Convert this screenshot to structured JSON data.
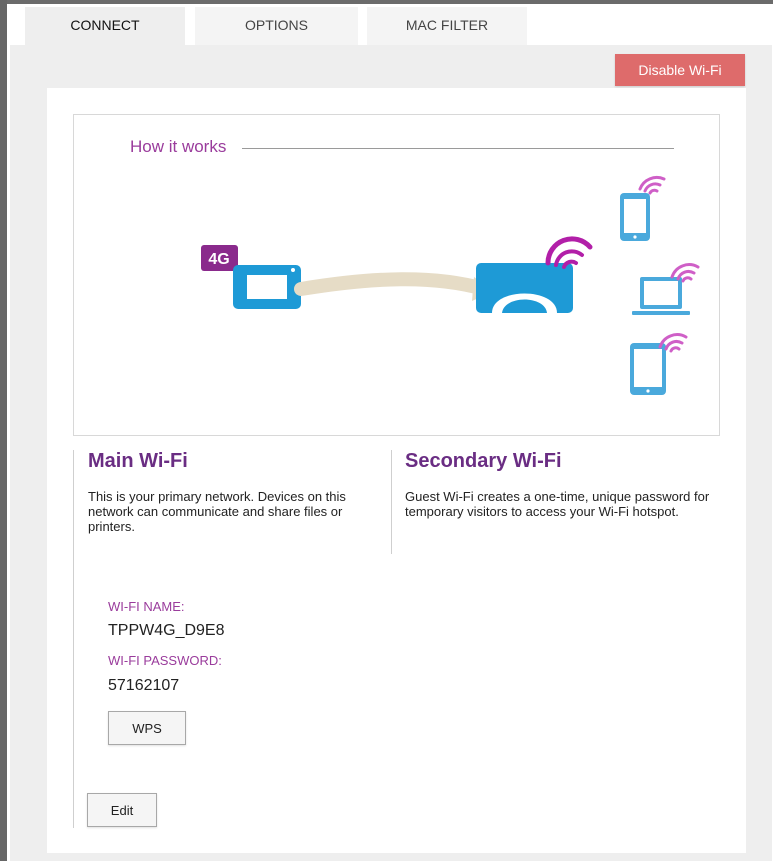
{
  "tabs": [
    {
      "label": "CONNECT",
      "active": true
    },
    {
      "label": "OPTIONS",
      "active": false
    },
    {
      "label": "MAC FILTER",
      "active": false
    }
  ],
  "toolbar": {
    "disable_label": "Disable Wi-Fi"
  },
  "diagram": {
    "title": "How it works",
    "badge": "4G"
  },
  "main": {
    "title": "Main Wi-Fi",
    "description": "This is your primary network. Devices on this network can communicate and share files or printers."
  },
  "secondary": {
    "title": "Secondary Wi-Fi",
    "description": "Guest Wi-Fi creates a one-time, unique password for temporary visitors to access your Wi-Fi hotspot."
  },
  "fields": {
    "name_label": "WI-FI NAME:",
    "name_value": "TPPW4G_D9E8",
    "password_label": "WI-FI PASSWORD:",
    "password_value": "57162107"
  },
  "buttons": {
    "wps_label": "WPS",
    "edit_label": "Edit"
  },
  "colors": {
    "accent_purple": "#9a3c9c",
    "title_purple": "#6a2d83",
    "device_blue": "#1e9ad6",
    "danger": "#de6b6b"
  }
}
